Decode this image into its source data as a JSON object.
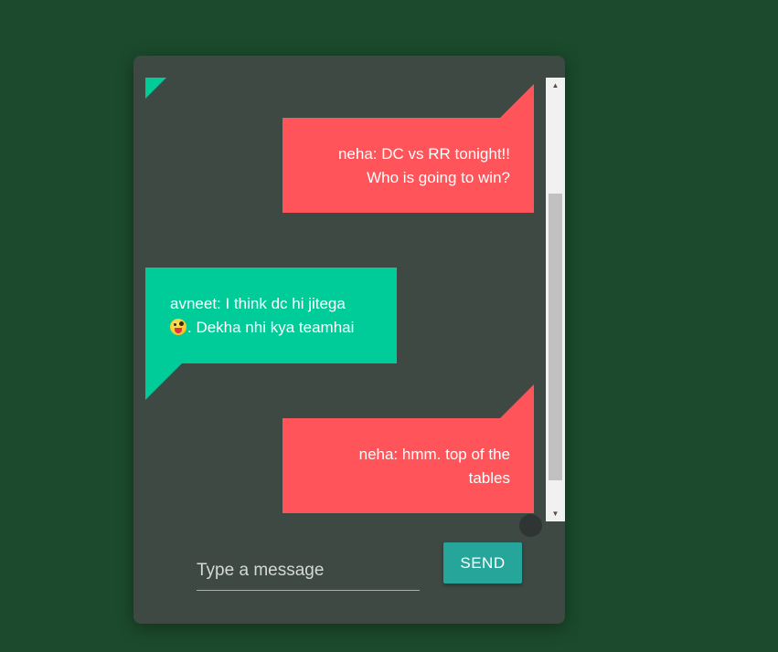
{
  "colors": {
    "page_background": "#1b4a2c",
    "card_background": "#3e4944",
    "outgoing_bubble": "#ff5459",
    "incoming_bubble": "#00cc99",
    "send_button": "#26a69a"
  },
  "messages": [
    {
      "direction": "outgoing",
      "line1": "neha: DC vs RR tonight!!",
      "line2": "Who is going to win?"
    },
    {
      "direction": "incoming",
      "line1": "avneet: I think dc hi jitega",
      "line2": ". Dekha nhi kya teamhai",
      "emoji": "tongue-out-emoji"
    },
    {
      "direction": "outgoing",
      "line1": "neha: hmm. top of the",
      "line2": "tables"
    }
  ],
  "composer": {
    "placeholder": "Type a message",
    "value": "",
    "send_label": "SEND"
  },
  "scrollbar": {
    "up_arrow_icon": "▲",
    "down_arrow_icon": "▼"
  }
}
